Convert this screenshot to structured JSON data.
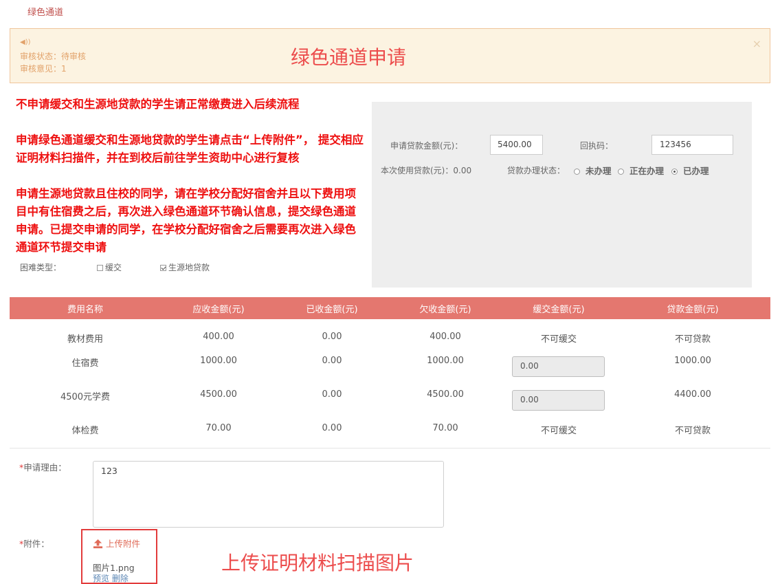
{
  "page_title": "绿色通道",
  "notice": {
    "speaker": "◀))",
    "status": "审核状态：待审核",
    "opinion": "审核意见：1",
    "close": "×",
    "annotation": "绿色通道申请"
  },
  "rules": [
    "不申请缓交和生源地贷款的学生请正常缴费进入后续流程",
    "申请绿色通道缓交和生源地贷款的学生请点击“上传附件”， 提交相应证明材料扫描件，并在到校后前往学生资助中心进行复核",
    "申请生源地贷款且住校的同学，请在学校分配好宿舍并且以下费用项目中有住宿费之后，再次进入绿色通道环节确认信息，提交绿色通道申请。已提交申请的同学，在学校分配好宿舍之后需要再次进入绿色通道环节提交申请"
  ],
  "hardship": {
    "label": "困难类型：",
    "options": [
      {
        "label": "缓交",
        "checked": false
      },
      {
        "label": "生源地贷款",
        "checked": true
      }
    ]
  },
  "loan": {
    "amount_label": "申请贷款金额(元)：",
    "amount_value": "5400.00",
    "receipt_label": "回执码：",
    "receipt_value": "123456",
    "used_label": "本次使用贷款(元)：0.00",
    "status_label": "贷款办理状态：",
    "status_options": [
      {
        "label": "未办理",
        "checked": false
      },
      {
        "label": "正在办理",
        "checked": false
      },
      {
        "label": "已办理",
        "checked": true
      }
    ]
  },
  "fees": {
    "headers": [
      "费用名称",
      "应收金额(元)",
      "已收金额(元)",
      "欠收金额(元)",
      "缓交金额(元)",
      "贷款金额(元)"
    ],
    "rows": [
      {
        "name": "教材费用",
        "due": "400.00",
        "paid": "0.00",
        "owed": "400.00",
        "defer": "不可缓交",
        "defer_editable": false,
        "loan": "不可贷款"
      },
      {
        "name": "住宿费",
        "due": "1000.00",
        "paid": "0.00",
        "owed": "1000.00",
        "defer": "0.00",
        "defer_editable": true,
        "loan": "1000.00"
      },
      {
        "name": "4500元学费",
        "due": "4500.00",
        "paid": "0.00",
        "owed": "4500.00",
        "defer": "0.00",
        "defer_editable": true,
        "loan": "4400.00"
      },
      {
        "name": "体检费",
        "due": "70.00",
        "paid": "0.00",
        "owed": "70.00",
        "defer": "不可缓交",
        "defer_editable": false,
        "loan": "不可贷款"
      }
    ]
  },
  "reason": {
    "required_mark": "*",
    "label": "申请理由：",
    "value": "123"
  },
  "attachment": {
    "required_mark": "*",
    "label": "附件：",
    "upload_label": "上传附件",
    "file_name": "图片1.png",
    "preview_label": "预览",
    "delete_label": "删除",
    "annotation": "上传证明材料扫描图片"
  }
}
